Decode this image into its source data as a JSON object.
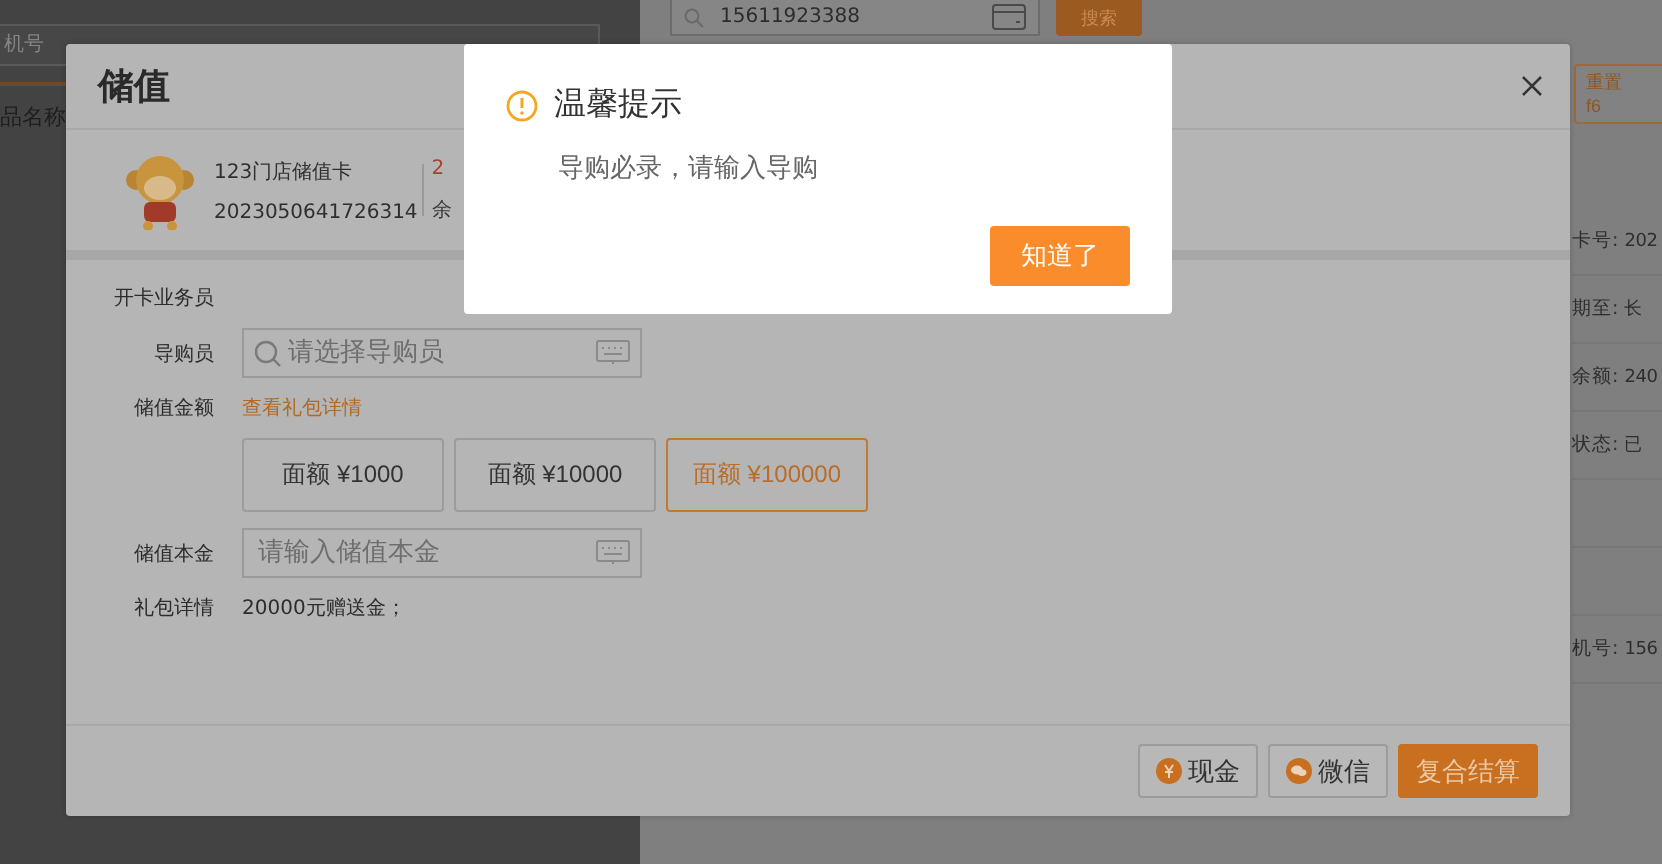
{
  "background_page": {
    "phone_field": {
      "placeholder": "机号"
    },
    "column_header": "品名称",
    "search_field": {
      "value": "15611923388"
    },
    "search_button": "搜索",
    "reset_button": {
      "label": "重置",
      "shortcut": "f6"
    },
    "info_rows": [
      {
        "label": "卡号:",
        "value": "202"
      },
      {
        "label": "期至:",
        "value": "长"
      },
      {
        "label": "余额:",
        "value": "240"
      },
      {
        "label": "状态:",
        "value": "已"
      },
      {
        "label": "机号:",
        "value": "156"
      }
    ]
  },
  "dialog": {
    "title": "储值",
    "card": {
      "name": "123门店储值卡",
      "number": "2023050641726314",
      "amount": "2",
      "amount_label": "余"
    },
    "form": {
      "clerk_label": "开卡业务员",
      "guide_label": "导购员",
      "guide_field": {
        "placeholder": "请选择导购员"
      },
      "amount_label": "储值金额",
      "gift_link": "查看礼包详情",
      "amounts": [
        {
          "label": "面额 ¥1000",
          "selected": false
        },
        {
          "label": "面额 ¥10000",
          "selected": false
        },
        {
          "label": "面额 ¥100000",
          "selected": true
        }
      ],
      "principal_label": "储值本金",
      "principal_field": {
        "placeholder": "请输入储值本金"
      },
      "gift_label": "礼包详情",
      "gift_text": "20000元赠送金；"
    },
    "buttons": [
      {
        "label": "现金",
        "kind": "cash"
      },
      {
        "label": "微信",
        "kind": "wechat"
      },
      {
        "label": "复合结算",
        "kind": "primary"
      }
    ]
  },
  "alert": {
    "title": "温馨提示",
    "message": "导购必录，请输入导购",
    "button": "知道了"
  }
}
